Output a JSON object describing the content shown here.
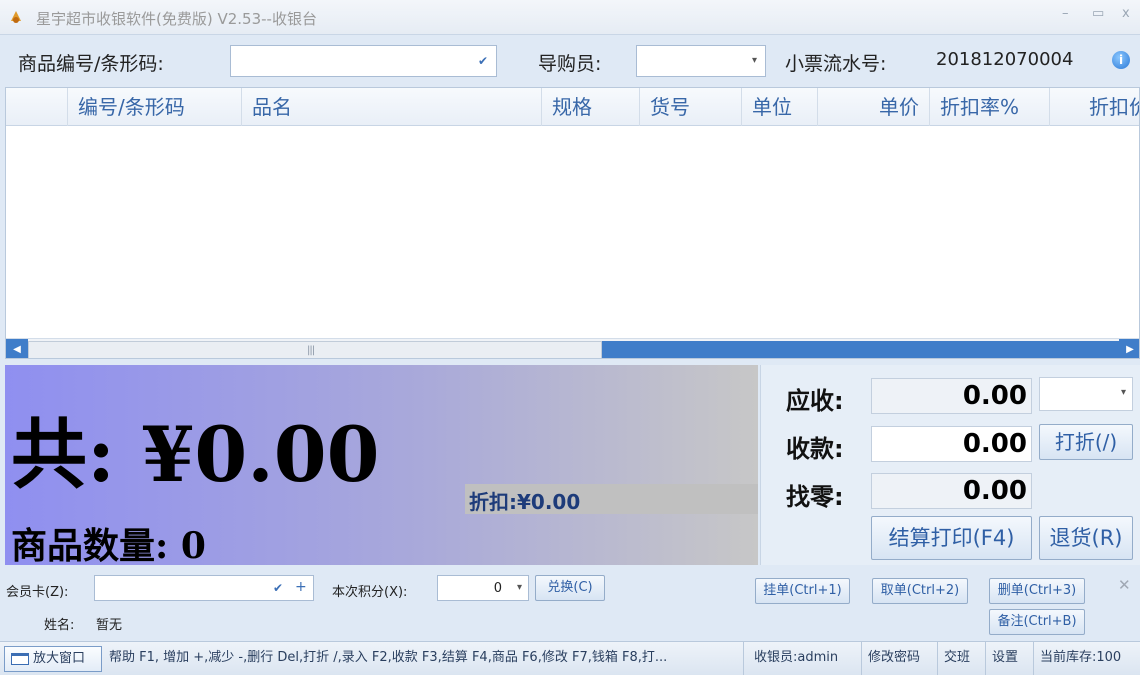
{
  "window": {
    "title": "星宇超市收银软件(免费版) V2.53--收银台",
    "minimize": "–",
    "maximize": "▭",
    "close": "x"
  },
  "top": {
    "barcode_label": "商品编号/条形码:",
    "barcode_value": "",
    "guide_label": "导购员:",
    "guide_value": "",
    "receipt_label": "小票流水号:",
    "receipt_number": "201812070004"
  },
  "grid": {
    "columns": [
      "",
      "编号/条形码",
      "品名",
      "规格",
      "货号",
      "单位",
      "单价",
      "折扣率%",
      "折扣价"
    ],
    "rows": []
  },
  "summary": {
    "total_text": "共:  ¥0.00",
    "discount_text": "折扣:¥0.00",
    "quantity_text": "商品数量:  0"
  },
  "payment": {
    "receivable_label": "应收:",
    "receivable_value": "0.00",
    "received_label": "收款:",
    "received_value": "0.00",
    "change_label": "找零:",
    "change_value": "0.00",
    "discount_button": "打折(/)",
    "checkout_button": "结算打印(F4)",
    "return_button": "退货(R)"
  },
  "member": {
    "card_label": "会员卡(Z):",
    "card_value": "",
    "points_label": "本次积分(X):",
    "points_value": "0",
    "redeem_button": "兑换(C)",
    "name_label": "姓名:",
    "name_value": "暂无",
    "hold_button": "挂单(Ctrl+1)",
    "retrieve_button": "取单(Ctrl+2)",
    "delete_button": "删单(Ctrl+3)",
    "note_button": "备注(Ctrl+B)"
  },
  "status": {
    "zoom_button": "放大窗口",
    "help_text": "帮助 F1, 增加 +,减少 -,删行 Del,打折 /,录入 F2,收款 F3,结算 F4,商品 F6,修改 F7,钱箱 F8,打...",
    "cashier": "收银员:admin",
    "change_password": "修改密码",
    "shift": "交班",
    "settings": "设置",
    "stock": "当前库存:100"
  },
  "colors": {
    "accent": "#3f7dc9",
    "header_text": "#3867a8",
    "panel_gradient_start": "#8f8ff0",
    "panel_gradient_end": "#c7c7c7"
  }
}
